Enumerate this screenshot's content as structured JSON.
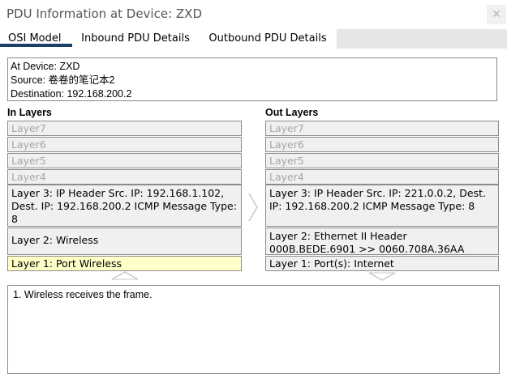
{
  "window": {
    "title": "PDU Information at Device: ZXD",
    "close_glyph": "✕"
  },
  "tabs": [
    {
      "label": "OSI Model",
      "active": true
    },
    {
      "label": "Inbound PDU Details"
    },
    {
      "label": "Outbound PDU Details"
    }
  ],
  "info": {
    "device": "At Device: ZXD",
    "source": "Source: 卷卷的笔记本2",
    "destination": "Destination: 192.168.200.2"
  },
  "in_layers": {
    "heading": "In Layers",
    "layer7": "Layer7",
    "layer6": "Layer6",
    "layer5": "Layer5",
    "layer4": "Layer4",
    "layer3": "Layer 3: IP Header Src. IP: 192.168.1.102, Dest. IP: 192.168.200.2 ICMP Message Type: 8",
    "layer2": "Layer 2: Wireless",
    "layer1": "Layer 1: Port Wireless"
  },
  "out_layers": {
    "heading": "Out Layers",
    "layer7": "Layer7",
    "layer6": "Layer6",
    "layer5": "Layer5",
    "layer4": "Layer4",
    "layer3": "Layer 3: IP Header Src. IP: 221.0.0.2, Dest. IP: 192.168.200.2 ICMP Message Type: 8",
    "layer2": "Layer 2: Ethernet II Header 000B.BEDE.6901 >> 0060.708A.36AA",
    "layer1": "Layer 1: Port(s): Internet"
  },
  "description": "1. Wireless receives the frame.",
  "colors": {
    "active_tab_underline": "#1c3f66",
    "highlight": "#ffffc8",
    "layer_bg": "#f0f0f0"
  }
}
